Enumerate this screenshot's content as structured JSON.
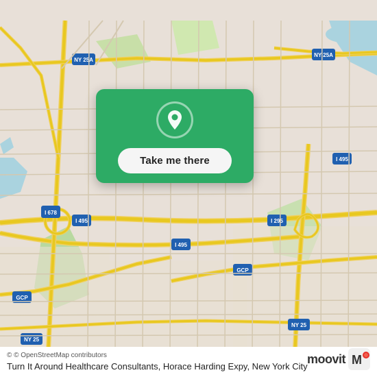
{
  "map": {
    "background_color": "#e8e0d8",
    "alt": "Map of Queens, New York City area showing highways I-495, I-678, I-295, NY 25A, NY 25, GCP routes"
  },
  "card": {
    "button_label": "Take me there",
    "location_icon": "map-pin"
  },
  "bottom_bar": {
    "attribution": "© OpenStreetMap contributors",
    "place_name": "Turn It Around Healthcare Consultants, Horace Harding Expy, New York City"
  },
  "moovit": {
    "text": "moovit"
  }
}
